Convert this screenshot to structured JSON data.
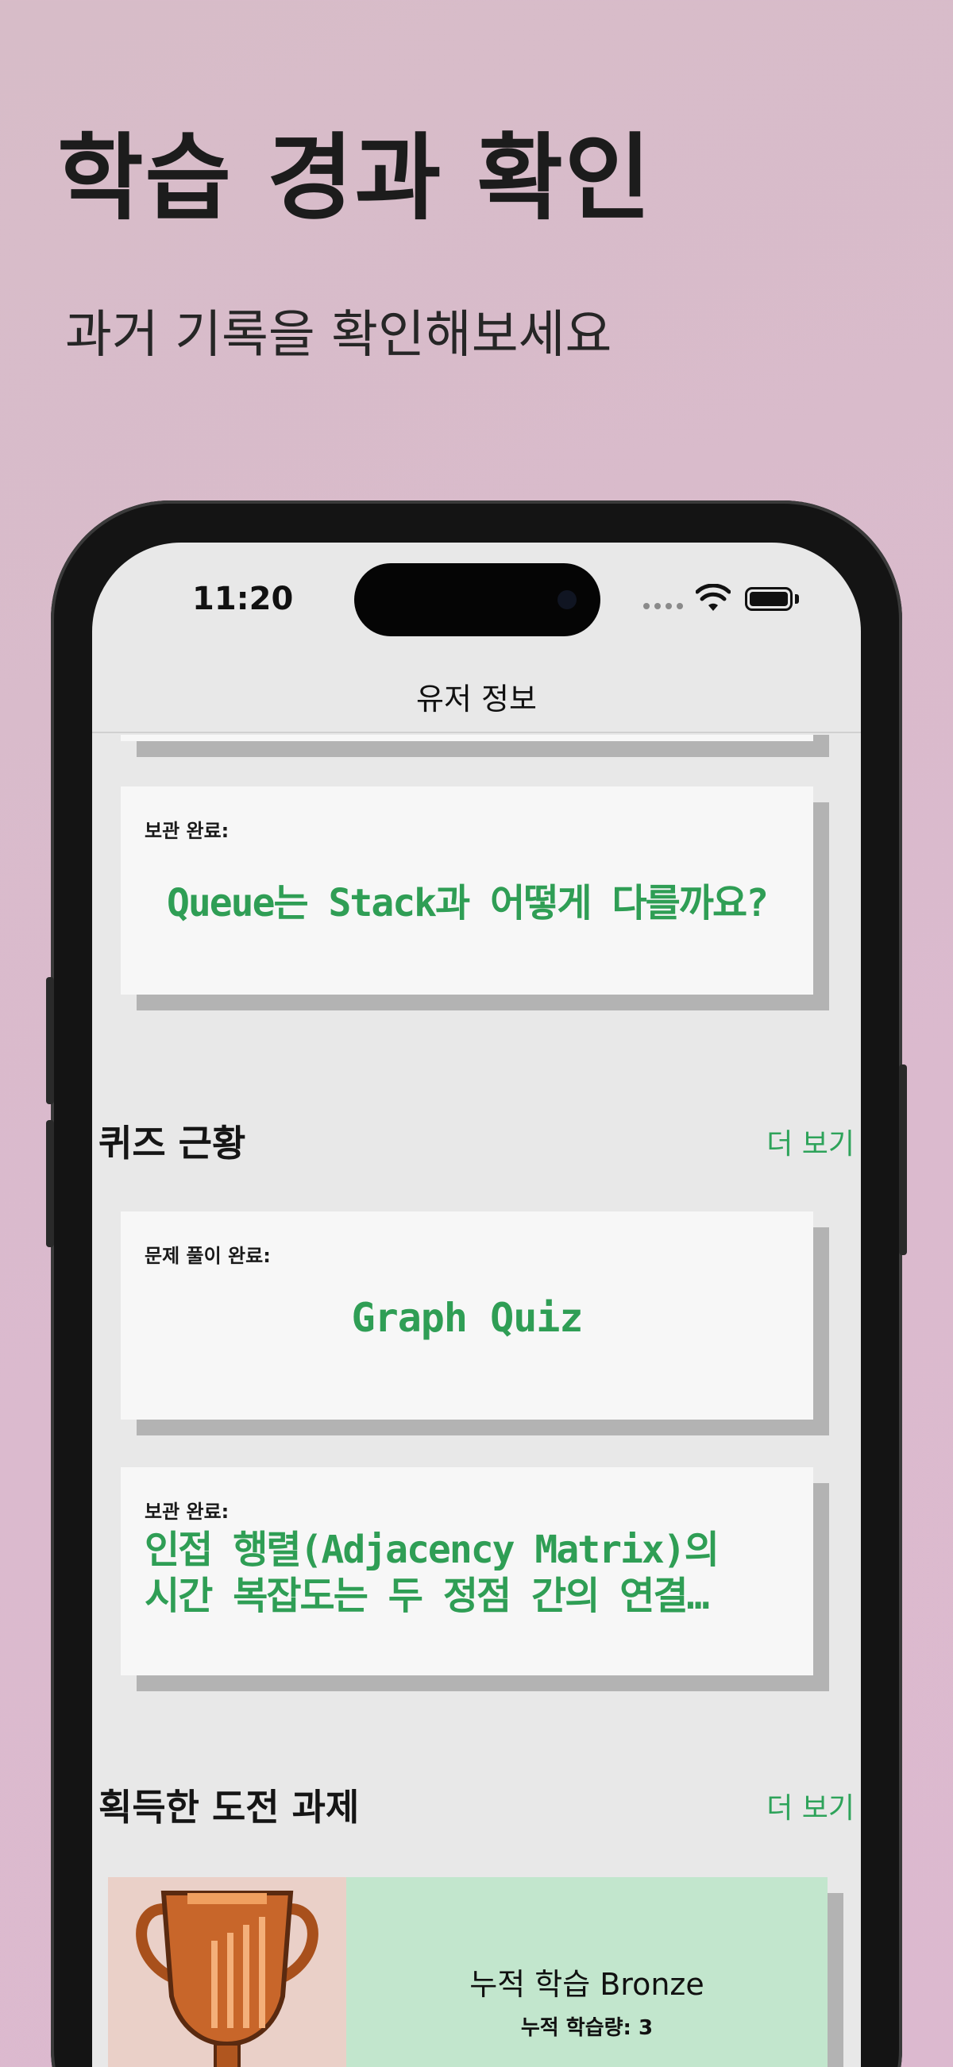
{
  "hero": {
    "title": "학습 경과 확인",
    "subtitle": "과거 기록을 확인해보세요"
  },
  "status_bar": {
    "time": "11:20",
    "icons": [
      "signal-dots-icon",
      "wifi-icon",
      "battery-icon"
    ]
  },
  "nav": {
    "title": "유저 정보"
  },
  "top_card": {
    "label": "보관 완료:",
    "text": "Queue는 Stack과 어떻게 다를까요?"
  },
  "quiz_section": {
    "title": "퀴즈 근황",
    "more_label": "더 보기",
    "cards": [
      {
        "label": "문제 풀이 완료:",
        "text": "Graph Quiz"
      },
      {
        "label": "보관 완료:",
        "line1": "인접 행렬(Adjacency Matrix)의",
        "line2": "시간 복잡도는 두 정점 간의 연결…"
      }
    ]
  },
  "challenge_section": {
    "title": "획득한 도전 과제",
    "more_label": "더 보기",
    "badge": {
      "icon": "trophy-icon",
      "title": "누적 학습 Bronze",
      "subtitle": "누적 학습량: 3"
    }
  },
  "colors": {
    "accent": "#2ea35a",
    "card_bg": "#f7f7f7",
    "badge_bg": "#c2e6cd",
    "screen_bg": "#e8e8e8"
  }
}
